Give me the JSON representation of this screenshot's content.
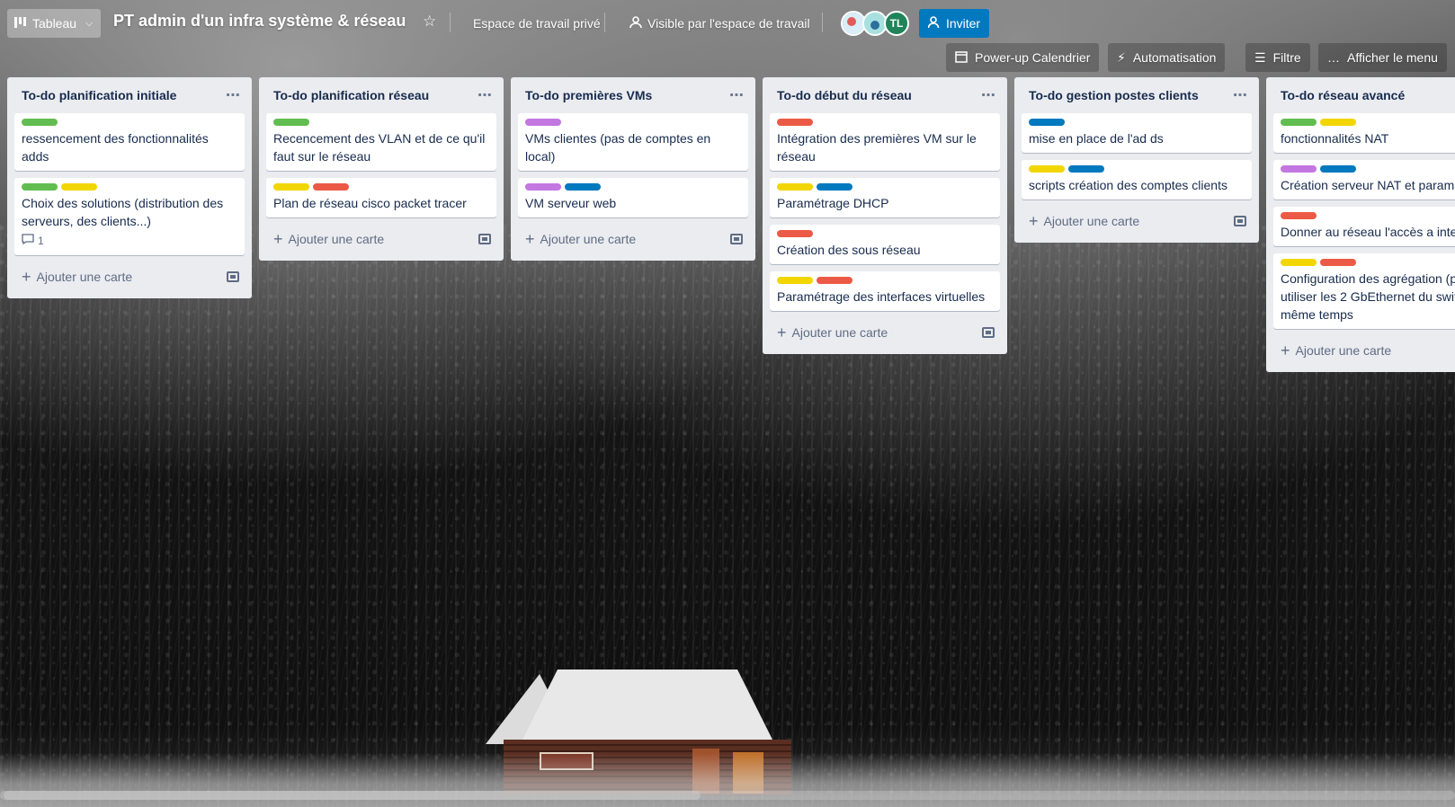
{
  "header": {
    "view_label": "Tableau",
    "board_title": "PT admin d'un infra système & réseau",
    "workspace": "Espace de travail privé",
    "visibility": "Visible par l'espace de travail",
    "member_initials": "TL",
    "invite_label": "Inviter"
  },
  "subbar": {
    "calendar": "Power-up Calendrier",
    "automation": "Automatisation",
    "filter": "Filtre",
    "menu": "Afficher le menu"
  },
  "colors": {
    "green": "#61bd4f",
    "yellow": "#f2d600",
    "red": "#eb5a46",
    "purple": "#c377e0",
    "blue": "#0079bf"
  },
  "add_card_label": "Ajouter une carte",
  "lists": [
    {
      "title": "To-do planification initiale",
      "cards": [
        {
          "labels": [
            "green"
          ],
          "text": "ressencement des fonctionnalités adds"
        },
        {
          "labels": [
            "green",
            "yellow"
          ],
          "text": "Choix des solutions (distribution des serveurs, des clients...)",
          "comments": "1"
        }
      ]
    },
    {
      "title": "To-do planification réseau",
      "cards": [
        {
          "labels": [
            "green"
          ],
          "text": "Recencement des VLAN et de ce qu'il faut sur le réseau"
        },
        {
          "labels": [
            "yellow",
            "red"
          ],
          "text": "Plan de réseau cisco packet tracer"
        }
      ]
    },
    {
      "title": "To-do premières VMs",
      "cards": [
        {
          "labels": [
            "purple"
          ],
          "text": "VMs clientes (pas de comptes en local)"
        },
        {
          "labels": [
            "purple",
            "blue"
          ],
          "text": "VM serveur web"
        }
      ]
    },
    {
      "title": "To-do début du réseau",
      "cards": [
        {
          "labels": [
            "red"
          ],
          "text": "Intégration des premières VM sur le réseau"
        },
        {
          "labels": [
            "yellow",
            "blue"
          ],
          "text": "Paramétrage DHCP"
        },
        {
          "labels": [
            "red"
          ],
          "text": "Création des sous réseau"
        },
        {
          "labels": [
            "yellow",
            "red"
          ],
          "text": "Paramétrage des interfaces virtuelles"
        }
      ]
    },
    {
      "title": "To-do gestion postes clients",
      "cards": [
        {
          "labels": [
            "blue"
          ],
          "text": "mise en place de l'ad ds"
        },
        {
          "labels": [
            "yellow",
            "blue"
          ],
          "text": "scripts création des comptes clients"
        }
      ]
    },
    {
      "title": "To-do réseau avancé",
      "cards": [
        {
          "labels": [
            "green",
            "yellow"
          ],
          "text": "fonctionnalités NAT"
        },
        {
          "labels": [
            "purple",
            "blue"
          ],
          "text": "Création serveur NAT et param"
        },
        {
          "labels": [
            "red"
          ],
          "text": "Donner au réseau l'accès a inte"
        },
        {
          "labels": [
            "yellow",
            "red"
          ],
          "text": "Configuration des agrégation (p utiliser les 2 GbEthernet du swit même temps"
        }
      ]
    }
  ]
}
